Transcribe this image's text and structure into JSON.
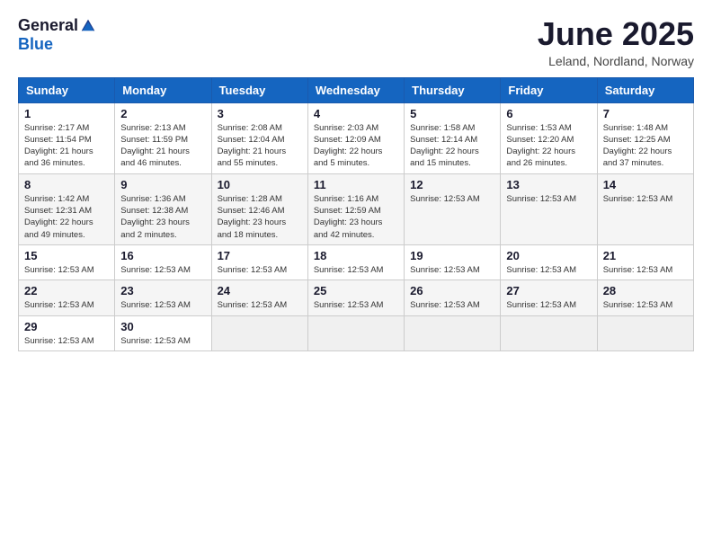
{
  "logo": {
    "general": "General",
    "blue": "Blue"
  },
  "title": "June 2025",
  "location": "Leland, Nordland, Norway",
  "weekdays": [
    "Sunday",
    "Monday",
    "Tuesday",
    "Wednesday",
    "Thursday",
    "Friday",
    "Saturday"
  ],
  "weeks": [
    [
      {
        "day": "1",
        "info": "Sunrise: 2:17 AM\nSunset: 11:54 PM\nDaylight: 21 hours\nand 36 minutes."
      },
      {
        "day": "2",
        "info": "Sunrise: 2:13 AM\nSunset: 11:59 PM\nDaylight: 21 hours\nand 46 minutes."
      },
      {
        "day": "3",
        "info": "Sunrise: 2:08 AM\nSunset: 12:04 AM\nDaylight: 21 hours\nand 55 minutes."
      },
      {
        "day": "4",
        "info": "Sunrise: 2:03 AM\nSunset: 12:09 AM\nDaylight: 22 hours\nand 5 minutes."
      },
      {
        "day": "5",
        "info": "Sunrise: 1:58 AM\nSunset: 12:14 AM\nDaylight: 22 hours\nand 15 minutes."
      },
      {
        "day": "6",
        "info": "Sunrise: 1:53 AM\nSunset: 12:20 AM\nDaylight: 22 hours\nand 26 minutes."
      },
      {
        "day": "7",
        "info": "Sunrise: 1:48 AM\nSunset: 12:25 AM\nDaylight: 22 hours\nand 37 minutes."
      }
    ],
    [
      {
        "day": "8",
        "info": "Sunrise: 1:42 AM\nSunset: 12:31 AM\nDaylight: 22 hours\nand 49 minutes."
      },
      {
        "day": "9",
        "info": "Sunrise: 1:36 AM\nSunset: 12:38 AM\nDaylight: 23 hours\nand 2 minutes."
      },
      {
        "day": "10",
        "info": "Sunrise: 1:28 AM\nSunset: 12:46 AM\nDaylight: 23 hours\nand 18 minutes."
      },
      {
        "day": "11",
        "info": "Sunrise: 1:16 AM\nSunset: 12:59 AM\nDaylight: 23 hours\nand 42 minutes."
      },
      {
        "day": "12",
        "info": "Sunrise: 12:53 AM"
      },
      {
        "day": "13",
        "info": "Sunrise: 12:53 AM"
      },
      {
        "day": "14",
        "info": "Sunrise: 12:53 AM"
      }
    ],
    [
      {
        "day": "15",
        "info": "Sunrise: 12:53 AM"
      },
      {
        "day": "16",
        "info": "Sunrise: 12:53 AM"
      },
      {
        "day": "17",
        "info": "Sunrise: 12:53 AM"
      },
      {
        "day": "18",
        "info": "Sunrise: 12:53 AM"
      },
      {
        "day": "19",
        "info": "Sunrise: 12:53 AM"
      },
      {
        "day": "20",
        "info": "Sunrise: 12:53 AM"
      },
      {
        "day": "21",
        "info": "Sunrise: 12:53 AM"
      }
    ],
    [
      {
        "day": "22",
        "info": "Sunrise: 12:53 AM"
      },
      {
        "day": "23",
        "info": "Sunrise: 12:53 AM"
      },
      {
        "day": "24",
        "info": "Sunrise: 12:53 AM"
      },
      {
        "day": "25",
        "info": "Sunrise: 12:53 AM"
      },
      {
        "day": "26",
        "info": "Sunrise: 12:53 AM"
      },
      {
        "day": "27",
        "info": "Sunrise: 12:53 AM"
      },
      {
        "day": "28",
        "info": "Sunrise: 12:53 AM"
      }
    ],
    [
      {
        "day": "29",
        "info": "Sunrise: 12:53 AM"
      },
      {
        "day": "30",
        "info": "Sunrise: 12:53 AM"
      },
      {
        "day": "",
        "info": ""
      },
      {
        "day": "",
        "info": ""
      },
      {
        "day": "",
        "info": ""
      },
      {
        "day": "",
        "info": ""
      },
      {
        "day": "",
        "info": ""
      }
    ]
  ]
}
